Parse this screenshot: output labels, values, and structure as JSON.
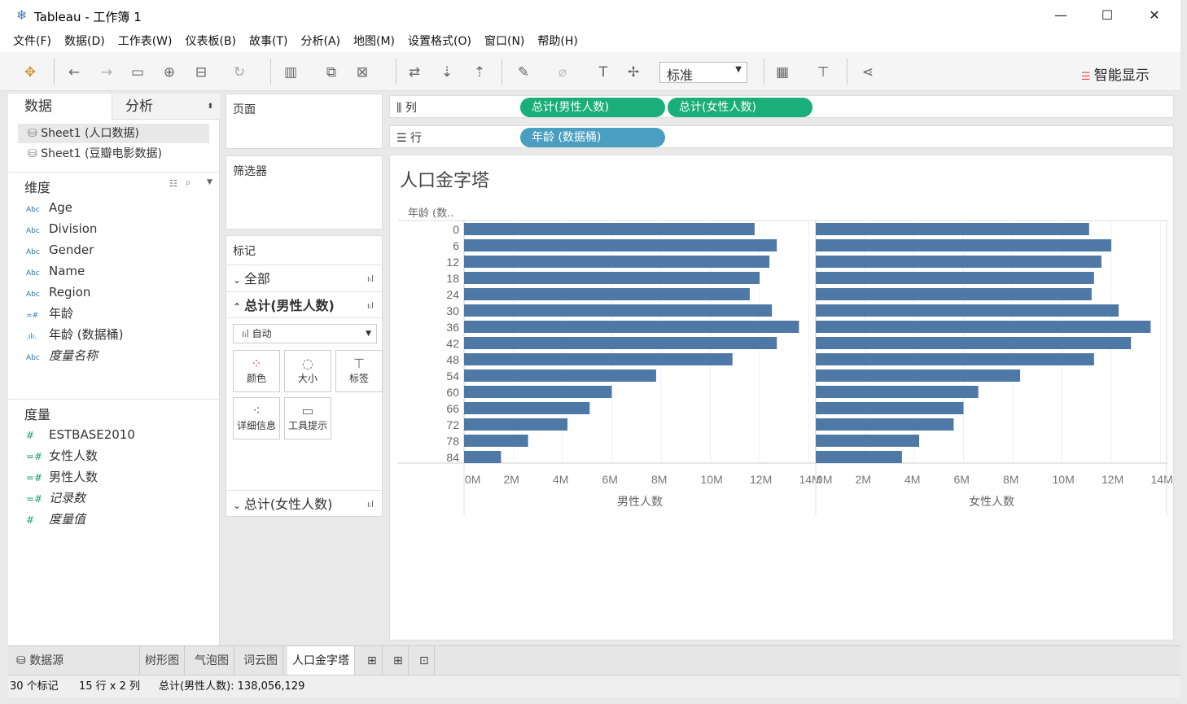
{
  "window": {
    "title": "Tableau - 工作簿 1",
    "minimize": "—",
    "maximize": "☐",
    "close": "✕"
  },
  "menu": [
    "文件(F)",
    "数据(D)",
    "工作表(W)",
    "仪表板(B)",
    "故事(T)",
    "分析(A)",
    "地图(M)",
    "设置格式(O)",
    "窗口(N)",
    "帮助(H)"
  ],
  "toolbar": {
    "fit_select": "标准",
    "smart_show": "智能显示"
  },
  "data_pane": {
    "tab_data": "数据",
    "tab_analysis": "分析",
    "sources": [
      "Sheet1 (人口数据)",
      "Sheet1 (豆瓣电影数据)"
    ],
    "dimensions_label": "维度",
    "dimensions": [
      {
        "type": "Abc",
        "name": "Age"
      },
      {
        "type": "Abc",
        "name": "Division"
      },
      {
        "type": "Abc",
        "name": "Gender"
      },
      {
        "type": "Abc",
        "name": "Name"
      },
      {
        "type": "Abc",
        "name": "Region"
      },
      {
        "type": "=#",
        "name": "年龄"
      },
      {
        "type": ".ılı.",
        "name": "年龄 (数据桶)"
      },
      {
        "type": "Abc",
        "name": "度量名称",
        "italic": true
      }
    ],
    "measures_label": "度量",
    "measures": [
      {
        "type": "#",
        "name": "ESTBASE2010"
      },
      {
        "type": "=#",
        "name": "女性人数"
      },
      {
        "type": "=#",
        "name": "男性人数"
      },
      {
        "type": "=#",
        "name": "记录数",
        "italic": true
      },
      {
        "type": "#",
        "name": "度量值",
        "italic": true
      }
    ]
  },
  "cards": {
    "pages": "页面",
    "filters": "筛选器",
    "marks": "标记",
    "all": "全部",
    "male_sum": "总计(男性人数)",
    "mark_type": "自动",
    "color": "颜色",
    "size": "大小",
    "label": "标签",
    "detail": "详细信息",
    "tooltip": "工具提示",
    "female_sum": "总计(女性人数)"
  },
  "shelves": {
    "columns_label": "列",
    "rows_label": "行",
    "columns": [
      "总计(男性人数)",
      "总计(女性人数)"
    ],
    "rows": [
      "年龄 (数据桶)"
    ]
  },
  "colors": {
    "bar": "#4e79a7",
    "measure_pill": "#1aae7b",
    "dimension_pill": "#4a9ec1"
  },
  "chart_data": {
    "type": "bar",
    "orientation": "horizontal",
    "title": "人口金字塔",
    "row_header": "年龄 (数..",
    "categories": [
      "0",
      "6",
      "12",
      "18",
      "24",
      "30",
      "36",
      "42",
      "48",
      "54",
      "60",
      "66",
      "72",
      "78",
      "84"
    ],
    "series": [
      {
        "name": "男性人数",
        "values": [
          11.8,
          12.7,
          12.4,
          12.0,
          11.6,
          12.5,
          13.6,
          12.7,
          10.9,
          7.8,
          6.0,
          5.1,
          4.2,
          2.6,
          1.5
        ]
      },
      {
        "name": "女性人数",
        "values": [
          11.1,
          12.0,
          11.6,
          11.3,
          11.2,
          12.3,
          13.6,
          12.8,
          11.3,
          8.3,
          6.6,
          6.0,
          5.6,
          4.2,
          3.5
        ]
      }
    ],
    "unit": "M",
    "xlim": [
      0,
      14
    ],
    "ticks": [
      "0M",
      "2M",
      "4M",
      "6M",
      "8M",
      "10M",
      "12M",
      "14M"
    ],
    "grid": true
  },
  "sheet_tabs": {
    "datasource": "数据源",
    "sheets": [
      "树形图",
      "气泡图",
      "词云图",
      "人口金字塔"
    ],
    "active": "人口金字塔"
  },
  "status": {
    "marks": "30 个标记",
    "dims": "15 行 x 2 列",
    "sum": "总计(男性人数): 138,056,129"
  }
}
